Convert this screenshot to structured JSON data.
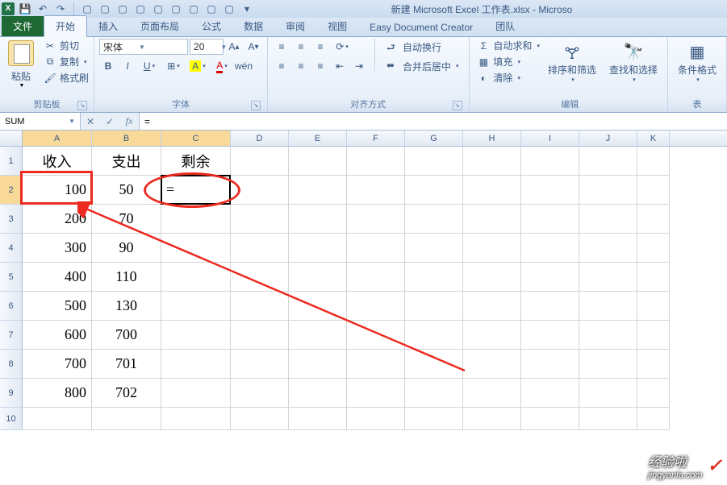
{
  "window": {
    "title": "新建 Microsoft Excel 工作表.xlsx - Microso",
    "app_icon_text": "X"
  },
  "tabs": {
    "file": "文件",
    "items": [
      "开始",
      "插入",
      "页面布局",
      "公式",
      "数据",
      "审阅",
      "视图",
      "Easy Document Creator",
      "团队"
    ],
    "active_index": 0
  },
  "ribbon": {
    "clipboard": {
      "paste": "粘贴",
      "cut": "剪切",
      "copy": "复制",
      "format_painter": "格式刷",
      "group_label": "剪贴板"
    },
    "font": {
      "name": "宋体",
      "size": "20",
      "group_label": "字体"
    },
    "alignment": {
      "wrap_text": "自动换行",
      "merge_center": "合并后居中",
      "group_label": "对齐方式"
    },
    "editing": {
      "autosum": "自动求和",
      "fill": "填充",
      "clear": "清除",
      "sort_filter": "排序和筛选",
      "find_select": "查找和选择",
      "group_label": "编辑"
    },
    "styles": {
      "cond_format": "条件格式",
      "table": "表"
    }
  },
  "formula_bar": {
    "name_box": "SUM",
    "formula": "="
  },
  "grid": {
    "columns": [
      "A",
      "B",
      "C",
      "D",
      "E",
      "F",
      "G",
      "H",
      "I",
      "J",
      "K"
    ],
    "active_cell": "C2",
    "headers": [
      "收入",
      "支出",
      "剩余"
    ],
    "data": [
      {
        "A": "100",
        "B": "50",
        "C": "="
      },
      {
        "A": "200",
        "B": "70",
        "C": ""
      },
      {
        "A": "300",
        "B": "90",
        "C": ""
      },
      {
        "A": "400",
        "B": "110",
        "C": ""
      },
      {
        "A": "500",
        "B": "130",
        "C": ""
      },
      {
        "A": "600",
        "B": "700",
        "C": ""
      },
      {
        "A": "700",
        "B": "701",
        "C": ""
      },
      {
        "A": "800",
        "B": "702",
        "C": ""
      }
    ]
  },
  "watermark": {
    "main": "经验啦",
    "sub": "jingyanla.com"
  }
}
